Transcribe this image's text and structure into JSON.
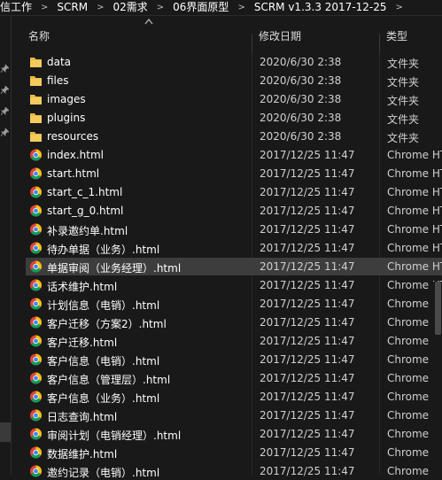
{
  "breadcrumb": [
    "信工作",
    "SCRM",
    "02需求",
    "06界面原型",
    "SCRM v1.3.3 2017-12-25"
  ],
  "columns": {
    "name": "名称",
    "date": "修改日期",
    "type": "类型"
  },
  "files": [
    {
      "name": "data",
      "date": "2020/6/30 2:38",
      "type": "文件夹",
      "kind": "folder"
    },
    {
      "name": "files",
      "date": "2020/6/30 2:38",
      "type": "文件夹",
      "kind": "folder"
    },
    {
      "name": "images",
      "date": "2020/6/30 2:38",
      "type": "文件夹",
      "kind": "folder"
    },
    {
      "name": "plugins",
      "date": "2020/6/30 2:38",
      "type": "文件夹",
      "kind": "folder"
    },
    {
      "name": "resources",
      "date": "2020/6/30 2:38",
      "type": "文件夹",
      "kind": "folder"
    },
    {
      "name": "index.html",
      "date": "2017/12/25 11:47",
      "type": "Chrome HT",
      "kind": "chrome"
    },
    {
      "name": "start.html",
      "date": "2017/12/25 11:47",
      "type": "Chrome HT",
      "kind": "chrome"
    },
    {
      "name": "start_c_1.html",
      "date": "2017/12/25 11:47",
      "type": "Chrome HT",
      "kind": "chrome"
    },
    {
      "name": "start_g_0.html",
      "date": "2017/12/25 11:47",
      "type": "Chrome HT",
      "kind": "chrome"
    },
    {
      "name": "补录邀约单.html",
      "date": "2017/12/25 11:47",
      "type": "Chrome HT",
      "kind": "chrome"
    },
    {
      "name": "待办单据（业务）.html",
      "date": "2017/12/25 11:47",
      "type": "Chrome HT",
      "kind": "chrome"
    },
    {
      "name": "单据审阅（业务经理）.html",
      "date": "2017/12/25 11:47",
      "type": "Chrome HT",
      "kind": "chrome",
      "selected": true
    },
    {
      "name": "话术维护.html",
      "date": "2017/12/25 11:47",
      "type": "Chrome HT",
      "kind": "chrome"
    },
    {
      "name": "计划信息（电销）.html",
      "date": "2017/12/25 11:47",
      "type": "Chrome HT",
      "kind": "chrome"
    },
    {
      "name": "客户迁移（方案2）.html",
      "date": "2017/12/25 11:47",
      "type": "Chrome HT",
      "kind": "chrome"
    },
    {
      "name": "客户迁移.html",
      "date": "2017/12/25 11:47",
      "type": "Chrome HT",
      "kind": "chrome"
    },
    {
      "name": "客户信息（电销）.html",
      "date": "2017/12/25 11:47",
      "type": "Chrome HT",
      "kind": "chrome"
    },
    {
      "name": "客户信息（管理层）.html",
      "date": "2017/12/25 11:47",
      "type": "Chrome HT",
      "kind": "chrome"
    },
    {
      "name": "客户信息（业务）.html",
      "date": "2017/12/25 11:47",
      "type": "Chrome HT",
      "kind": "chrome"
    },
    {
      "name": "日志查询.html",
      "date": "2017/12/25 11:47",
      "type": "Chrome HT",
      "kind": "chrome"
    },
    {
      "name": "审阅计划（电销经理）.html",
      "date": "2017/12/25 11:47",
      "type": "Chrome HT",
      "kind": "chrome"
    },
    {
      "name": "数据维护.html",
      "date": "2017/12/25 11:47",
      "type": "Chrome HT",
      "kind": "chrome"
    },
    {
      "name": "邀约记录（电销）.html",
      "date": "2017/12/25 11:47",
      "type": "Chrome HT",
      "kind": "chrome"
    }
  ],
  "colors": {
    "folder": "#e8b84a",
    "chrome_red": "#db4437",
    "chrome_yellow": "#f4c20d",
    "chrome_green": "#0f9d58",
    "chrome_blue": "#4285f4"
  }
}
